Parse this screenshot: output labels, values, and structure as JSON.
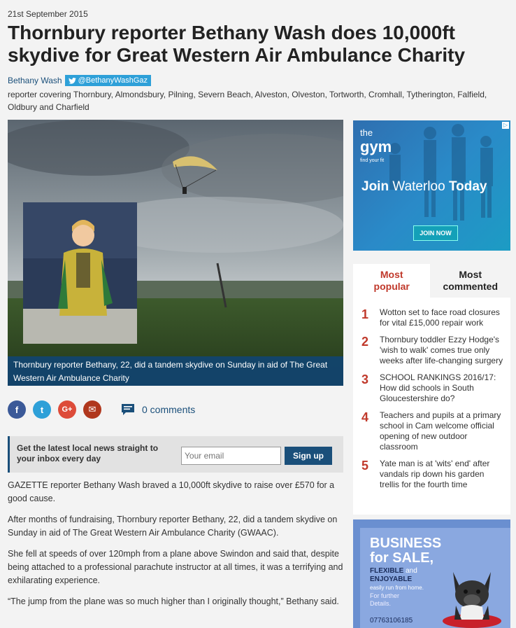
{
  "article": {
    "date": "21st September 2015",
    "headline": "Thornbury reporter Bethany Wash does 10,000ft skydive for Great Western Air Ambulance Charity",
    "author": "Bethany Wash",
    "twitter_handle": "@BethanyWashGaz",
    "bio": "reporter covering Thornbury, Almondsbury, Pilning, Severn Beach, Alveston, Olveston, Tortworth, Cromhall, Tytherington, Falfield, Oldbury and Charfield",
    "image_caption": "Thornbury reporter Bethany, 22, did a tandem skydive on Sunday in aid of The Great Western Air Ambulance Charity",
    "comments_label": "0 comments",
    "paragraphs": [
      "GAZETTE reporter Bethany Wash braved a 10,000ft skydive to raise over £570 for a good cause.",
      "After months of fundraising, Thornbury reporter Bethany, 22, did a tandem skydive on Sunday in aid of The Great Western Air Ambulance Charity (GWAAC).",
      "She fell at speeds of over 120mph from a plane above Swindon and said that, despite being attached to a professional parachute instructor at all times, it was a terrifying and exhilarating experience.",
      "“The jump from the plane was so much higher than I originally thought,” Bethany said."
    ]
  },
  "share": {
    "icons": [
      "facebook-icon",
      "twitter-icon",
      "googleplus-icon",
      "email-icon"
    ],
    "glyphs": [
      "f",
      "t",
      "G+",
      "✉"
    ]
  },
  "newsletter": {
    "prompt": "Get the latest local news straight to your inbox every day",
    "placeholder": "Your email",
    "button": "Sign up"
  },
  "ads": {
    "gym": {
      "logo_line1": "the",
      "logo_line2": "gym",
      "logo_tag": "find your fit",
      "join": "Join",
      "place": "Waterloo",
      "today": "Today",
      "cta": "JOIN NOW"
    },
    "business": {
      "line1": "BUSINESS",
      "line2": "for SALE,",
      "line3": "FLEXIBLE",
      "and": "and",
      "line4": "ENJOYABLE",
      "line5": "easily run from home.",
      "line6": "For further",
      "line7": "Details.",
      "phone": "07763106185"
    }
  },
  "sidebar": {
    "tab_popular": "Most popular",
    "tab_commented": "Most commented",
    "items": [
      {
        "num": "1",
        "title": "Wotton set to face road closures for vital £15,000 repair work"
      },
      {
        "num": "2",
        "title": "Thornbury toddler Ezzy Hodge's 'wish to walk' comes true only weeks after life-changing surgery"
      },
      {
        "num": "3",
        "title": "SCHOOL RANKINGS 2016/17: How did schools in South Gloucestershire do?"
      },
      {
        "num": "4",
        "title": "Teachers and pupils at a primary school in Cam welcome official opening of new outdoor classroom"
      },
      {
        "num": "5",
        "title": "Yate man is at 'wits' end' after vandals rip down his garden trellis for the fourth time"
      }
    ]
  },
  "colors": {
    "brand_blue": "#1a4f7a",
    "accent_red": "#c0392b",
    "twitter_blue": "#2ea0d8"
  }
}
